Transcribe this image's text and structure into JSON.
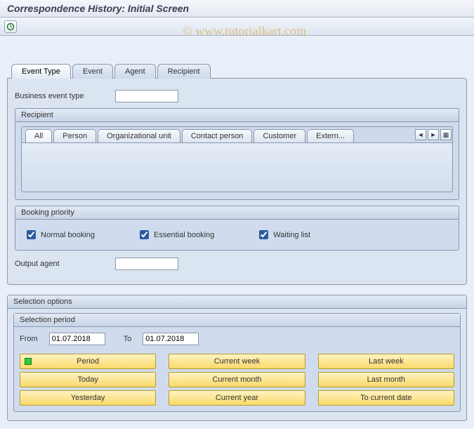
{
  "title": "Correspondence History: Initial Screen",
  "watermark": "© www.tutorialkart.com",
  "topTabs": {
    "t0": "Event Type",
    "t1": "Event",
    "t2": "Agent",
    "t3": "Recipient"
  },
  "businessEventType": {
    "label": "Business event type",
    "value": ""
  },
  "recipient": {
    "title": "Recipient",
    "tabs": {
      "r0": "All",
      "r1": "Person",
      "r2": "Organizational unit",
      "r3": "Contact person",
      "r4": "Customer",
      "r5": "Extern..."
    }
  },
  "bookingPriority": {
    "title": "Booking priority",
    "normal": {
      "label": "Normal booking",
      "checked": true
    },
    "essential": {
      "label": "Essential booking",
      "checked": true
    },
    "waiting": {
      "label": "Waiting list",
      "checked": true
    }
  },
  "outputAgent": {
    "label": "Output agent",
    "value": ""
  },
  "selectionOptions": {
    "title": "Selection options",
    "period": {
      "title": "Selection period",
      "fromLabel": "From",
      "fromValue": "01.07.2018",
      "toLabel": "To",
      "toValue": "01.07.2018"
    },
    "buttons": {
      "b0": "Period",
      "b1": "Current week",
      "b2": "Last week",
      "b3": "Today",
      "b4": "Current month",
      "b5": "Last month",
      "b6": "Yesterday",
      "b7": "Current year",
      "b8": "To current date"
    }
  }
}
